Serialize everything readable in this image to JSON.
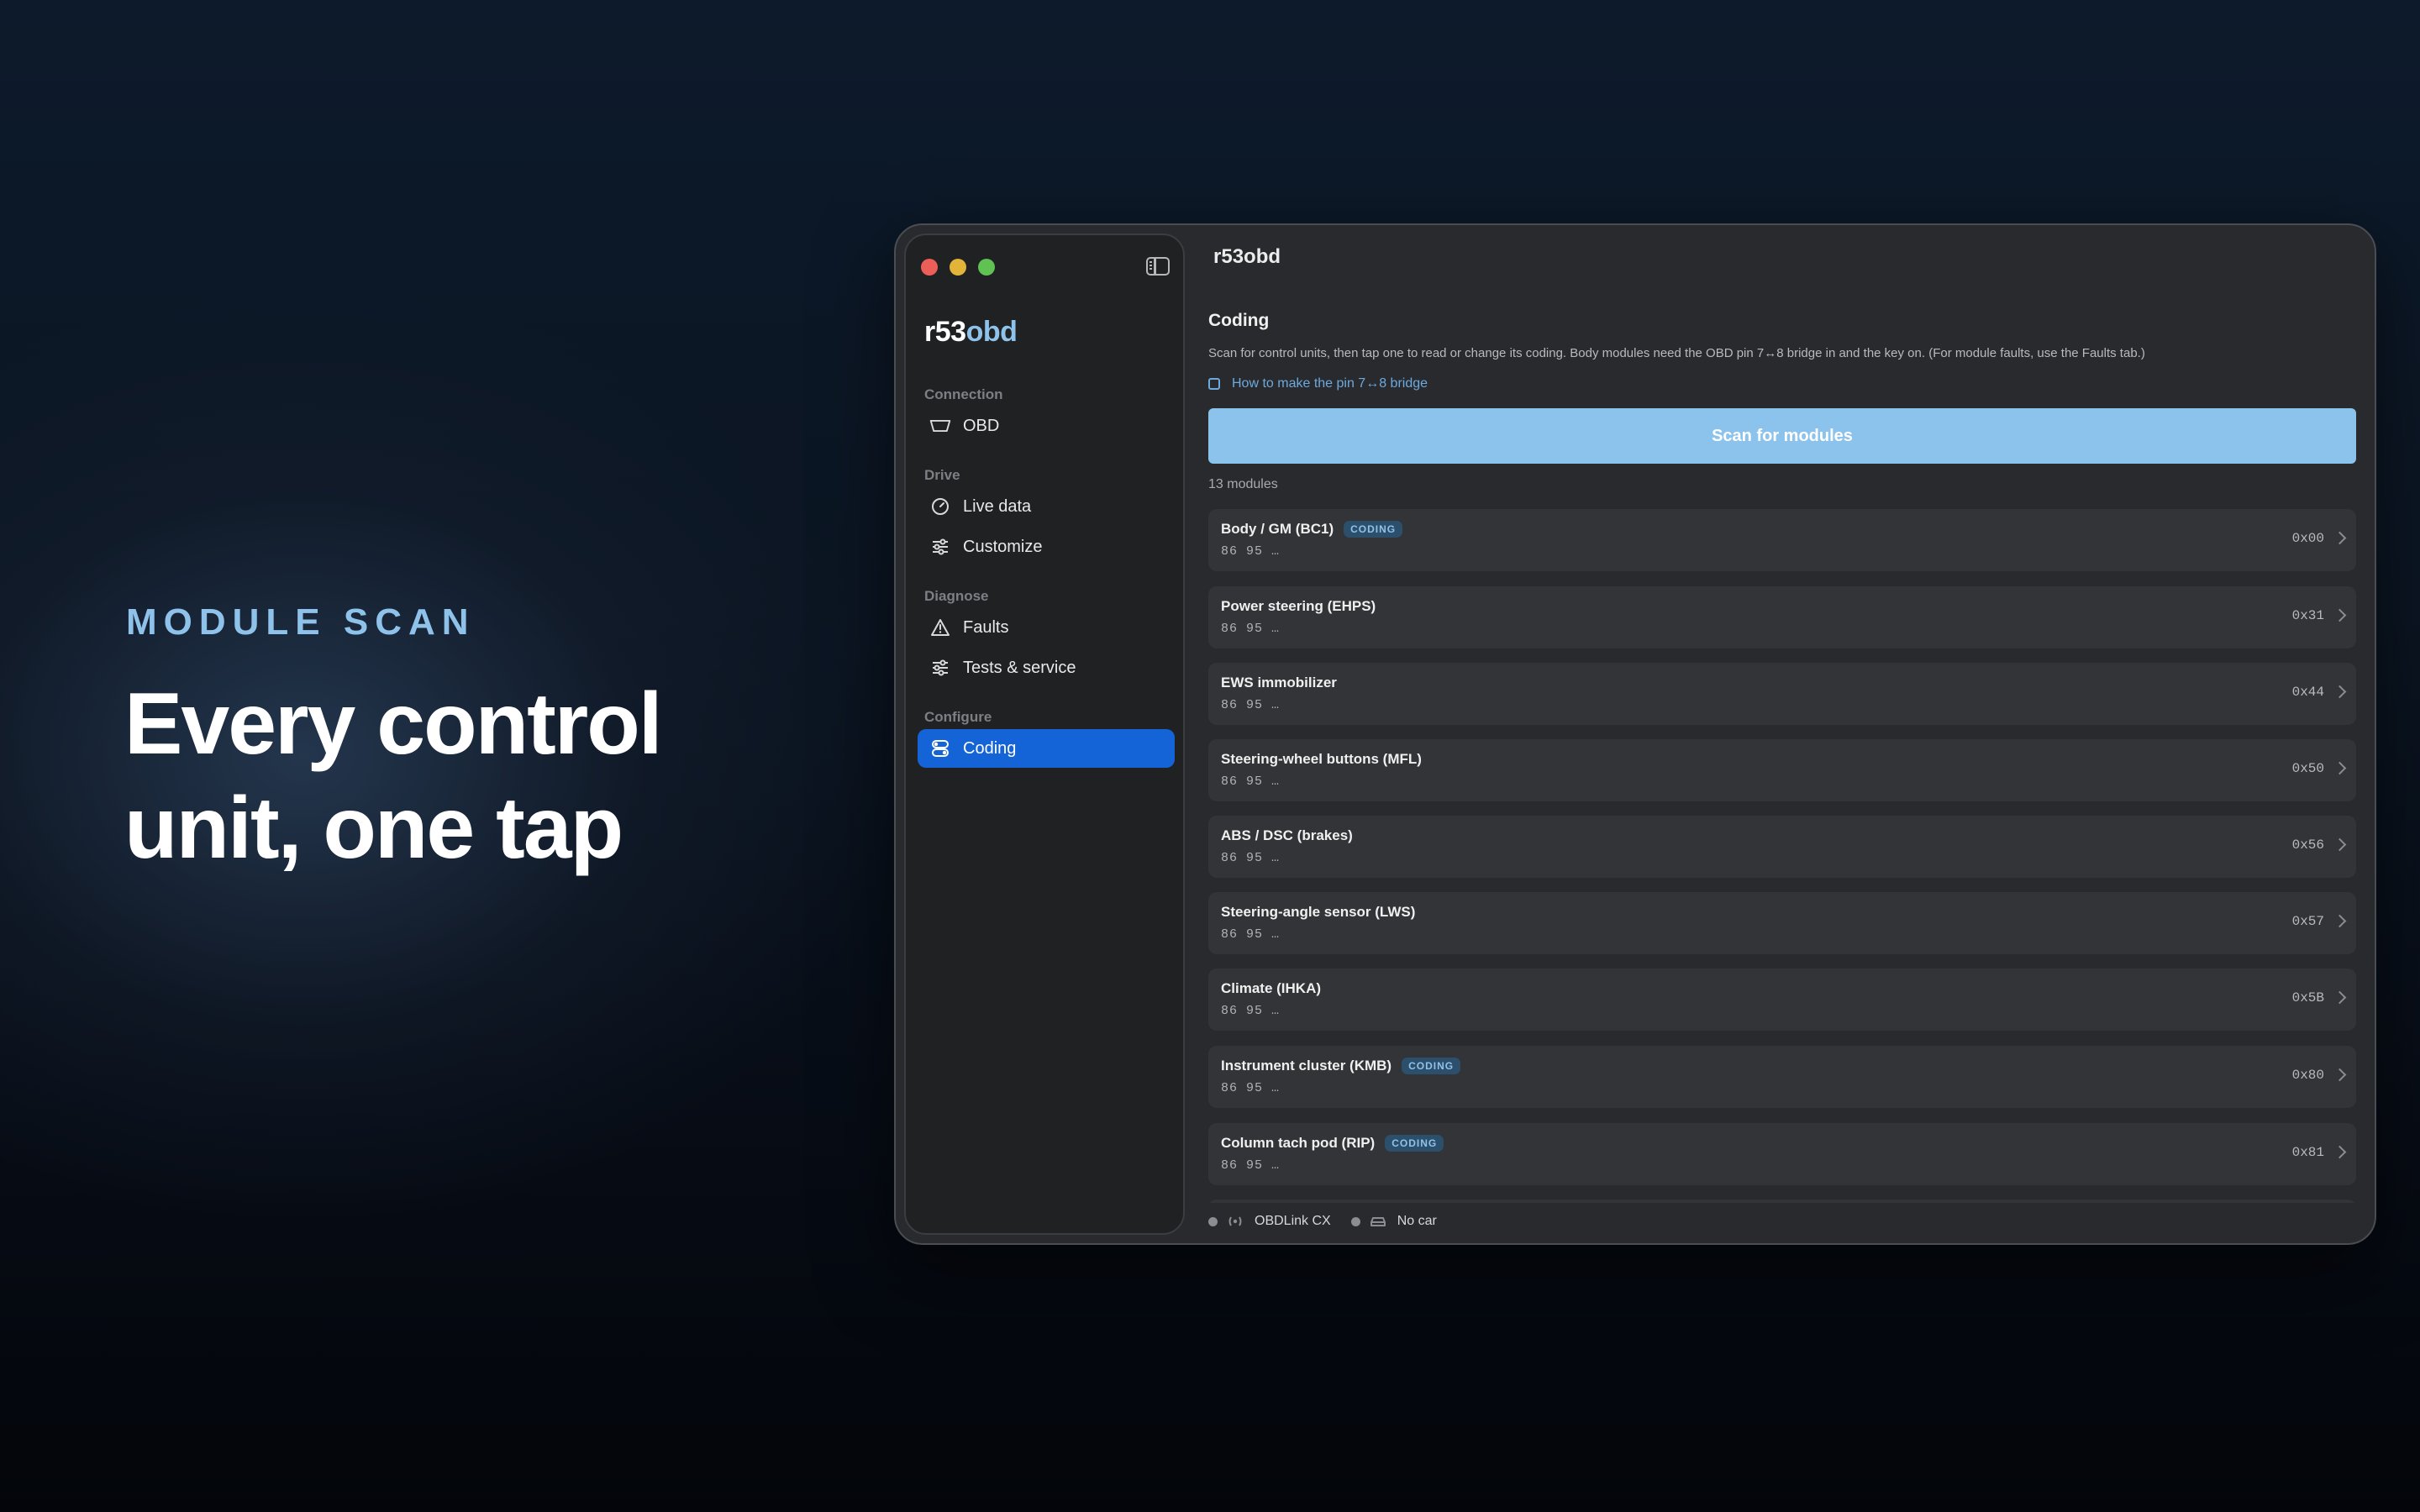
{
  "hero": {
    "eyebrow": "MODULE SCAN",
    "title": "Every control unit, one tap"
  },
  "window": {
    "title": "r53obd"
  },
  "sidebar": {
    "brand_prefix": "r53",
    "brand_suffix": "obd",
    "sections": {
      "connection": "Connection",
      "drive": "Drive",
      "diagnose": "Diagnose",
      "configure": "Configure"
    },
    "items": {
      "obd": "OBD",
      "live_data": "Live data",
      "customize": "Customize",
      "faults": "Faults",
      "tests": "Tests & service",
      "coding": "Coding"
    }
  },
  "main": {
    "title": "Coding",
    "description": "Scan for control units, then tap one to read or change its coding. Body modules need the OBD pin 7↔8 bridge in and the key on. (For module faults, use the Faults tab.)",
    "link": "How to make the pin 7↔8 bridge",
    "scan_button": "Scan for modules",
    "count": "13 modules",
    "badge_label": "CODING",
    "modules": [
      {
        "name": "Body / GM (BC1)",
        "coding": true,
        "sub": "86 95 …",
        "addr": "0x00"
      },
      {
        "name": "Power steering (EHPS)",
        "coding": false,
        "sub": "86 95 …",
        "addr": "0x31"
      },
      {
        "name": "EWS immobilizer",
        "coding": false,
        "sub": "86 95 …",
        "addr": "0x44"
      },
      {
        "name": "Steering-wheel buttons (MFL)",
        "coding": false,
        "sub": "86 95 …",
        "addr": "0x50"
      },
      {
        "name": "ABS / DSC (brakes)",
        "coding": false,
        "sub": "86 95 …",
        "addr": "0x56"
      },
      {
        "name": "Steering-angle sensor (LWS)",
        "coding": false,
        "sub": "86 95 …",
        "addr": "0x57"
      },
      {
        "name": "Climate (IHKA)",
        "coding": false,
        "sub": "86 95 …",
        "addr": "0x5B"
      },
      {
        "name": "Instrument cluster (KMB)",
        "coding": true,
        "sub": "86 95 …",
        "addr": "0x80"
      },
      {
        "name": "Column tach pod (RIP)",
        "coding": true,
        "sub": "86 95 …",
        "addr": "0x81"
      },
      {
        "name": "",
        "coding": false,
        "sub": "",
        "addr": ""
      }
    ]
  },
  "status": {
    "adapter": "OBDLink CX",
    "car": "No car"
  }
}
